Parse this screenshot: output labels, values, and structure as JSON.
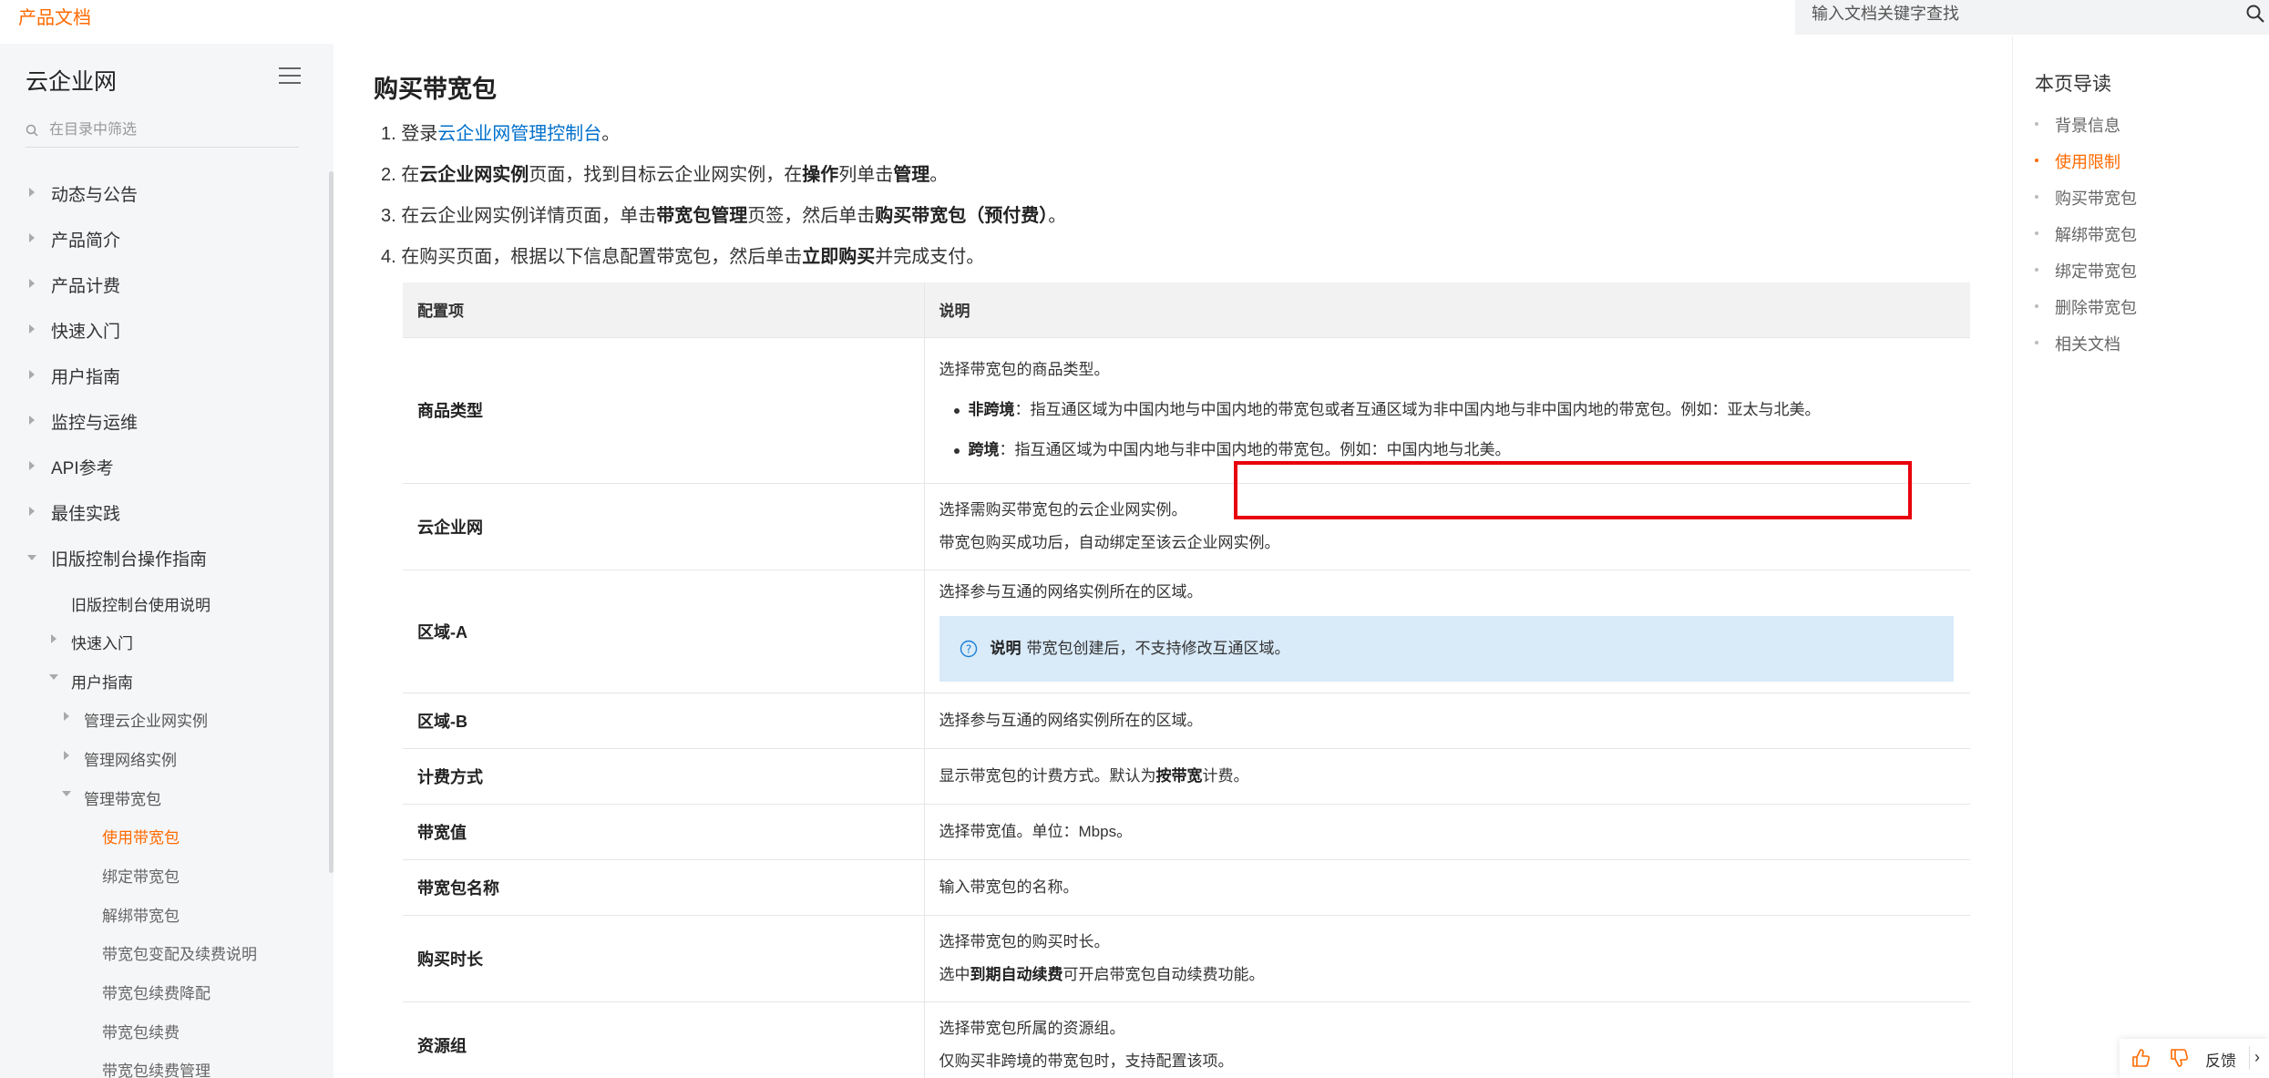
{
  "header": {
    "brand": "产品文档",
    "search_placeholder": "输入文档关键字查找"
  },
  "sidebar": {
    "title": "云企业网",
    "filter_placeholder": "在目录中筛选",
    "items": [
      {
        "label": "动态与公告"
      },
      {
        "label": "产品简介"
      },
      {
        "label": "产品计费"
      },
      {
        "label": "快速入门"
      },
      {
        "label": "用户指南"
      },
      {
        "label": "监控与运维"
      },
      {
        "label": "API参考"
      },
      {
        "label": "最佳实践"
      },
      {
        "label": "旧版控制台操作指南"
      },
      {
        "label": "旧版控制台使用说明"
      },
      {
        "label": "快速入门"
      },
      {
        "label": "用户指南"
      },
      {
        "label": "管理云企业网实例"
      },
      {
        "label": "管理网络实例"
      },
      {
        "label": "管理带宽包"
      },
      {
        "label": "使用带宽包"
      },
      {
        "label": "绑定带宽包"
      },
      {
        "label": "解绑带宽包"
      },
      {
        "label": "带宽包变配及续费说明"
      },
      {
        "label": "带宽包续费降配"
      },
      {
        "label": "带宽包续费"
      },
      {
        "label": "带宽包续费管理"
      }
    ]
  },
  "main": {
    "title": "购买带宽包",
    "steps": [
      {
        "num": "1.",
        "a": "登录",
        "link": "云企业网管理控制台",
        "b": "。"
      },
      {
        "num": "2.",
        "a": "在",
        "bold1": "云企业网实例",
        "b": "页面，找到目标云企业网实例，在",
        "bold2": "操作",
        "c": "列单击",
        "bold3": "管理",
        "d": "。"
      },
      {
        "num": "3.",
        "a": "在云企业网实例详情页面，单击",
        "bold1": "带宽包管理",
        "b": "页签，然后单击",
        "bold2": "购买带宽包（预付费）",
        "c": "。"
      },
      {
        "num": "4.",
        "a": "在购买页面，根据以下信息配置带宽包，然后单击",
        "bold1": "立即购买",
        "b": "并完成支付。"
      }
    ],
    "table": {
      "headers": [
        "配置项",
        "说明"
      ],
      "rows": {
        "product_type": {
          "key": "商品类型",
          "desc": "选择带宽包的商品类型。",
          "b1_bold": "非跨境",
          "b1_text": "：指互通区域为中国内地与中国内地的带宽包或者互通区域为非中国内地与非中国内地的带宽包。例如：亚太与北美。",
          "b2_bold": "跨境",
          "b2_text": "：指互通区域为中国内地与非中国内地的带宽包。例如：中国内地与北美。"
        },
        "cen": {
          "key": "云企业网",
          "l1": "选择需购买带宽包的云企业网实例。",
          "l2": "带宽包购买成功后，自动绑定至该云企业网实例。"
        },
        "region_a": {
          "key": "区域-A",
          "l1": "选择参与互通的网络实例所在的区域。",
          "note_label": "说明",
          "note_text": "带宽包创建后，不支持修改互通区域。"
        },
        "region_b": {
          "key": "区域-B",
          "l1": "选择参与互通的网络实例所在的区域。"
        },
        "billing": {
          "key": "计费方式",
          "a": "显示带宽包的计费方式。默认为",
          "bold": "按带宽",
          "b": "计费。"
        },
        "bandwidth": {
          "key": "带宽值",
          "l1": "选择带宽值。单位：Mbps。"
        },
        "name": {
          "key": "带宽包名称",
          "l1": "输入带宽包的名称。"
        },
        "duration": {
          "key": "购买时长",
          "l1": "选择带宽包的购买时长。",
          "a": "选中",
          "bold": "到期自动续费",
          "b": "可开启带宽包自动续费功能。"
        },
        "resource_group": {
          "key": "资源组",
          "l1": "选择带宽包所属的资源组。",
          "l2": "仅购买非跨境的带宽包时，支持配置该项。"
        }
      }
    }
  },
  "toc": {
    "title": "本页导读",
    "items": [
      "背景信息",
      "使用限制",
      "购买带宽包",
      "解绑带宽包",
      "绑定带宽包",
      "删除带宽包",
      "相关文档"
    ]
  },
  "feedback": {
    "label": "反馈",
    "arrow": "›"
  },
  "colors": {
    "accent": "#ff6a00",
    "link": "#0070cc",
    "highlight": "#e8000b",
    "note_bg": "#d9eaf9"
  }
}
